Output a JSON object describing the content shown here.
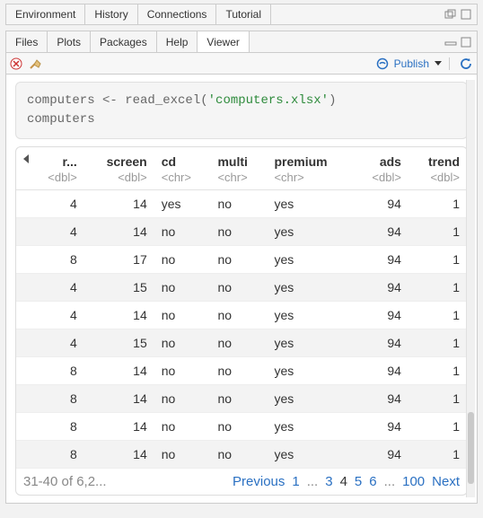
{
  "top_tabs": [
    "Environment",
    "History",
    "Connections",
    "Tutorial"
  ],
  "bottom_tabs": [
    "Files",
    "Plots",
    "Packages",
    "Help",
    "Viewer"
  ],
  "active_bottom_tab": "Viewer",
  "toolbar": {
    "publish_label": "Publish"
  },
  "code": {
    "pre": "computers <- read_excel(",
    "str": "'computers.xlsx'",
    "post": ")",
    "line2": "computers"
  },
  "columns": [
    {
      "name": "r...",
      "type": "<dbl>",
      "align": "right"
    },
    {
      "name": "screen",
      "type": "<dbl>",
      "align": "right"
    },
    {
      "name": "cd",
      "type": "<chr>",
      "align": "left"
    },
    {
      "name": "multi",
      "type": "<chr>",
      "align": "left"
    },
    {
      "name": "premium",
      "type": "<chr>",
      "align": "left"
    },
    {
      "name": "ads",
      "type": "<dbl>",
      "align": "right"
    },
    {
      "name": "trend",
      "type": "<dbl>",
      "align": "right"
    }
  ],
  "rows": [
    [
      "4",
      "14",
      "yes",
      "no",
      "yes",
      "94",
      "1"
    ],
    [
      "4",
      "14",
      "no",
      "no",
      "yes",
      "94",
      "1"
    ],
    [
      "8",
      "17",
      "no",
      "no",
      "yes",
      "94",
      "1"
    ],
    [
      "4",
      "15",
      "no",
      "no",
      "yes",
      "94",
      "1"
    ],
    [
      "4",
      "14",
      "no",
      "no",
      "yes",
      "94",
      "1"
    ],
    [
      "4",
      "15",
      "no",
      "no",
      "yes",
      "94",
      "1"
    ],
    [
      "8",
      "14",
      "no",
      "no",
      "yes",
      "94",
      "1"
    ],
    [
      "8",
      "14",
      "no",
      "no",
      "yes",
      "94",
      "1"
    ],
    [
      "8",
      "14",
      "no",
      "no",
      "yes",
      "94",
      "1"
    ],
    [
      "8",
      "14",
      "no",
      "no",
      "yes",
      "94",
      "1"
    ]
  ],
  "footer": {
    "counts": "31-40 of 6,2...",
    "prev": "Previous",
    "pages": [
      {
        "label": "1",
        "kind": "link"
      },
      {
        "label": "...",
        "kind": "ell"
      },
      {
        "label": "3",
        "kind": "link"
      },
      {
        "label": "4",
        "kind": "cur"
      },
      {
        "label": "5",
        "kind": "link"
      },
      {
        "label": "6",
        "kind": "link"
      },
      {
        "label": "...",
        "kind": "ell"
      },
      {
        "label": "100",
        "kind": "link"
      }
    ],
    "next": "Next"
  },
  "chart_data": {
    "type": "table",
    "title": "computers",
    "columns": [
      "r...",
      "screen",
      "cd",
      "multi",
      "premium",
      "ads",
      "trend"
    ],
    "column_types": [
      "dbl",
      "dbl",
      "chr",
      "chr",
      "chr",
      "dbl",
      "dbl"
    ],
    "row_range": "31-40",
    "total_rows_display": "6,2...",
    "rows": [
      {
        "r": 4,
        "screen": 14,
        "cd": "yes",
        "multi": "no",
        "premium": "yes",
        "ads": 94,
        "trend": 1
      },
      {
        "r": 4,
        "screen": 14,
        "cd": "no",
        "multi": "no",
        "premium": "yes",
        "ads": 94,
        "trend": 1
      },
      {
        "r": 8,
        "screen": 17,
        "cd": "no",
        "multi": "no",
        "premium": "yes",
        "ads": 94,
        "trend": 1
      },
      {
        "r": 4,
        "screen": 15,
        "cd": "no",
        "multi": "no",
        "premium": "yes",
        "ads": 94,
        "trend": 1
      },
      {
        "r": 4,
        "screen": 14,
        "cd": "no",
        "multi": "no",
        "premium": "yes",
        "ads": 94,
        "trend": 1
      },
      {
        "r": 4,
        "screen": 15,
        "cd": "no",
        "multi": "no",
        "premium": "yes",
        "ads": 94,
        "trend": 1
      },
      {
        "r": 8,
        "screen": 14,
        "cd": "no",
        "multi": "no",
        "premium": "yes",
        "ads": 94,
        "trend": 1
      },
      {
        "r": 8,
        "screen": 14,
        "cd": "no",
        "multi": "no",
        "premium": "yes",
        "ads": 94,
        "trend": 1
      },
      {
        "r": 8,
        "screen": 14,
        "cd": "no",
        "multi": "no",
        "premium": "yes",
        "ads": 94,
        "trend": 1
      },
      {
        "r": 8,
        "screen": 14,
        "cd": "no",
        "multi": "no",
        "premium": "yes",
        "ads": 94,
        "trend": 1
      }
    ]
  }
}
